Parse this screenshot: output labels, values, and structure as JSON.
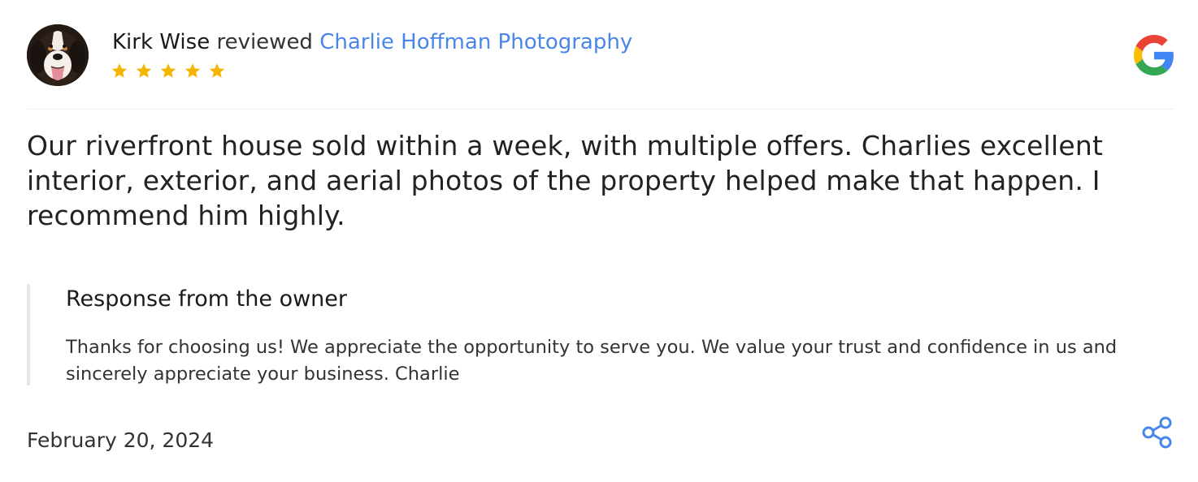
{
  "review": {
    "reviewer_name": "Kirk Wise",
    "reviewed_word": "reviewed",
    "business_name": "Charlie Hoffman Photography",
    "rating": 5,
    "rating_max": 5,
    "text": "Our riverfront house sold within a week, with multiple offers. Charlies excellent interior, exterior, and aerial photos of the property helped make that happen. I recommend him highly.",
    "date": "February 20, 2024"
  },
  "owner_response": {
    "title": "Response from the owner",
    "text": "Thanks for choosing us! We appreciate the opportunity to serve you. We value your trust and confidence in us and sincerely appreciate your business. Charlie"
  },
  "icons": {
    "avatar": "dog-avatar",
    "star": "star-icon",
    "source": "google-icon",
    "share": "share-icon"
  },
  "colors": {
    "link": "#4a86e8",
    "star": "#f4b400",
    "share": "#4a86e8",
    "google_blue": "#4285F4",
    "google_red": "#EA4335",
    "google_yellow": "#FBBC05",
    "google_green": "#34A853"
  }
}
